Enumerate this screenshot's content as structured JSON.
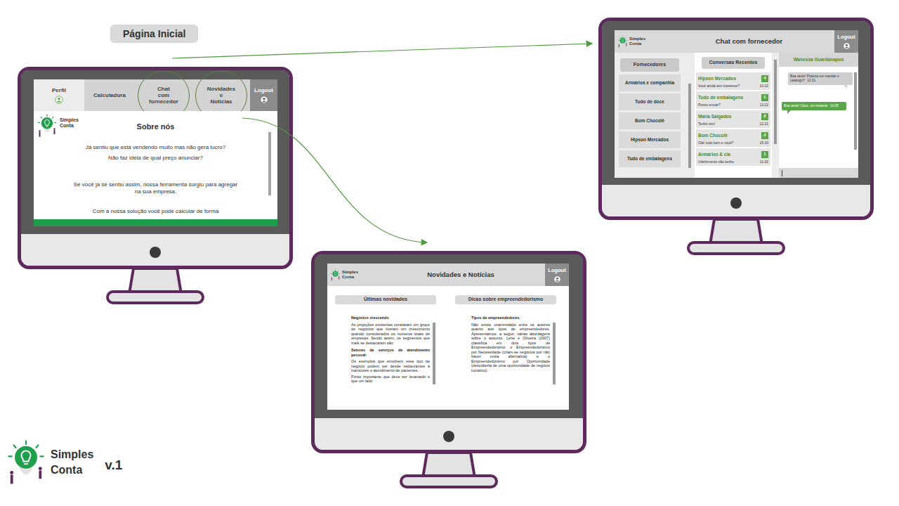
{
  "label": "Página Inicial",
  "brand": {
    "line1": "Simples",
    "line2": "Conta",
    "version": "v.1"
  },
  "home": {
    "nav": [
      {
        "kind": "profile",
        "lines": [
          "Perfil"
        ],
        "highlighted": false
      },
      {
        "kind": "tab",
        "lines": [
          "Calculadora"
        ],
        "highlighted": false
      },
      {
        "kind": "tab",
        "lines": [
          "Chat",
          "com",
          "fornecedor"
        ],
        "highlighted": true
      },
      {
        "kind": "tab",
        "lines": [
          "Novidades",
          "e",
          "Notícias"
        ],
        "highlighted": true
      },
      {
        "kind": "logout",
        "lines": [
          "Logout"
        ],
        "highlighted": false
      }
    ],
    "logo": [
      "Simples",
      "Conta"
    ],
    "title": "Sobre nós",
    "paragraphs": [
      "Já sentiu que está vendendo muito mas não gera lucro?",
      "Não faz ideia de qual preço anunciar?",
      "Se você ja se sentiu assim, nossa ferramenta surgiu para agregar na sua empresa.",
      "Com a nossa solução você pode calcular de forma"
    ]
  },
  "chat": {
    "logo": [
      "Simples",
      "Conta"
    ],
    "title": "Chat com fornecedor",
    "logout": "Logout",
    "suppliers_title": "Fornecedores",
    "suppliers": [
      "Armários e companhia",
      "Tudo de doce",
      "Bom Chocolê",
      "Hipson Mercados",
      "Tudo de embalagens"
    ],
    "recent_title": "Conversas Recentes",
    "conversations": [
      {
        "name": "Hipson Mercados",
        "preview": "Você ainda tem interesse?",
        "time": "10:22",
        "unread": "4"
      },
      {
        "name": "Tudo de embalagens",
        "preview": "Posso enviar?",
        "time": "13:22",
        "unread": "1"
      },
      {
        "name": "Maria Salgados",
        "preview": "Tenho sim!",
        "time": "12:21",
        "unread": "2"
      },
      {
        "name": "Bom Chocolê",
        "preview": "Olá! tudo bem e você?",
        "time": "15:33",
        "unread": "2"
      },
      {
        "name": "Armários & cia",
        "preview": "Infelizmente não tenho.",
        "time": "11:02",
        "unread": "1"
      }
    ],
    "contact": "Wanessa Guardanapos",
    "messages": [
      {
        "kind": "received",
        "text": "Boa tarde! Poderia me mandar o catálogo?",
        "time": "12:31"
      },
      {
        "kind": "sent",
        "text": "Boa tarde! Claro, um instante",
        "time": "14:25"
      }
    ]
  },
  "news": {
    "logo": [
      "Simples",
      "Conta"
    ],
    "title": "Novidades e Notícias",
    "logout": "Logout",
    "columns": [
      {
        "title": "Últimas novidades",
        "blocks": [
          {
            "kind": "heading",
            "text": "Negócios crescendo"
          },
          {
            "kind": "paragraph",
            "text": "As projeções existentes constatam um grupo de negócios que tiveram um crescimento quando considerados os números totais de empresas. Sendo assim, os segmentos que mais se destacaram são:"
          },
          {
            "kind": "heading",
            "text": "Setores de serviços de atendimento pessoal:"
          },
          {
            "kind": "paragraph",
            "text": "Os exemplos que envolvem esse tipo de negócio podem ser desde restaurantes à manicures e atendimento de pacientes."
          },
          {
            "kind": "paragraph",
            "text": "Ponto importante que deve ser levantado é que um lado"
          }
        ]
      },
      {
        "title": "Dicas sobre empreendedorismo",
        "blocks": [
          {
            "kind": "heading",
            "text": "Tipos de empreendedores."
          },
          {
            "kind": "paragraph",
            "text": "Não existe unanimidade entre os autores quanto aos tipos de empreendedores. Apresentamos, a seguir, várias abordagens sobre o assunto. Leite e Oliveira (2007) classifica em dois tipos de Empreendedorismo: o Empreendedorismo por Necessidade (criam-se negócios por não haver outra alternativa) e o Empreendedorismo por Oportunidade (descoberta de uma oportunidade de negócio lucrativo)."
          }
        ]
      }
    ]
  }
}
